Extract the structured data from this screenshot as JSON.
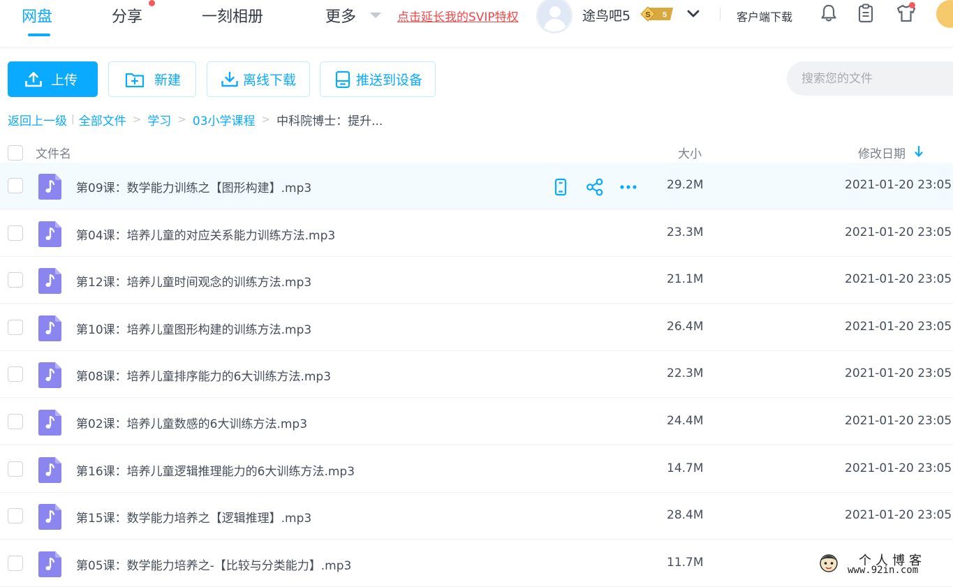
{
  "nav": {
    "tabs": [
      {
        "label": "网盘",
        "active": true
      },
      {
        "label": "分享",
        "has_dot": true
      },
      {
        "label": "一刻相册"
      },
      {
        "label": "更多"
      }
    ],
    "promo_link": "点击延长我的SVIP特权",
    "username": "途鸟吧5",
    "vip_level": "5",
    "client_download": "客户端下载",
    "icons": [
      "bell-icon",
      "clipboard-icon",
      "tshirt-icon"
    ],
    "accent_color": "#09aaff",
    "dot_color": "#f55a5a"
  },
  "toolbar": {
    "upload": "上传",
    "new_folder": "新建",
    "offline_download": "离线下载",
    "push_to_device": "推送到设备",
    "search_placeholder": "搜索您的文件"
  },
  "breadcrumb": {
    "back": "返回上一级",
    "items": [
      "全部文件",
      "学习",
      "03小学课程"
    ],
    "current": "中科院博士：提升..."
  },
  "table": {
    "headers": {
      "name": "文件名",
      "size": "大小",
      "modified": "修改日期"
    },
    "sort": "modified-desc",
    "rows": [
      {
        "name": "第09课：数学能力训练之【图形构建】.mp3",
        "size": "29.2M",
        "date": "2021-01-20 23:05",
        "hover": true
      },
      {
        "name": "第04课：培养儿童的对应关系能力训练方法.mp3",
        "size": "23.3M",
        "date": "2021-01-20 23:05"
      },
      {
        "name": "第12课：培养儿童时间观念的训练方法.mp3",
        "size": "21.1M",
        "date": "2021-01-20 23:05"
      },
      {
        "name": "第10课：培养儿童图形构建的训练方法.mp3",
        "size": "26.4M",
        "date": "2021-01-20 23:05"
      },
      {
        "name": "第08课：培养儿童排序能力的6大训练方法.mp3",
        "size": "22.3M",
        "date": "2021-01-20 23:05"
      },
      {
        "name": "第02课：培养儿童数感的6大训练方法.mp3",
        "size": "24.4M",
        "date": "2021-01-20 23:05"
      },
      {
        "name": "第16课：培养儿童逻辑推理能力的6大训练方法.mp3",
        "size": "14.7M",
        "date": "2021-01-20 23:05"
      },
      {
        "name": "第15课：数学能力培养之【逻辑推理】.mp3",
        "size": "28.4M",
        "date": "2021-01-20 23:05"
      },
      {
        "name": "第05课：数学能力培养之-【比较与分类能力】.mp3",
        "size": "11.7M",
        "date": ""
      }
    ],
    "row_actions": [
      "phone-icon",
      "share-icon",
      "more-icon"
    ],
    "file_icon_color": "#8b85f0"
  },
  "watermark": {
    "title": "个人博客",
    "url": "www.92in.com"
  }
}
